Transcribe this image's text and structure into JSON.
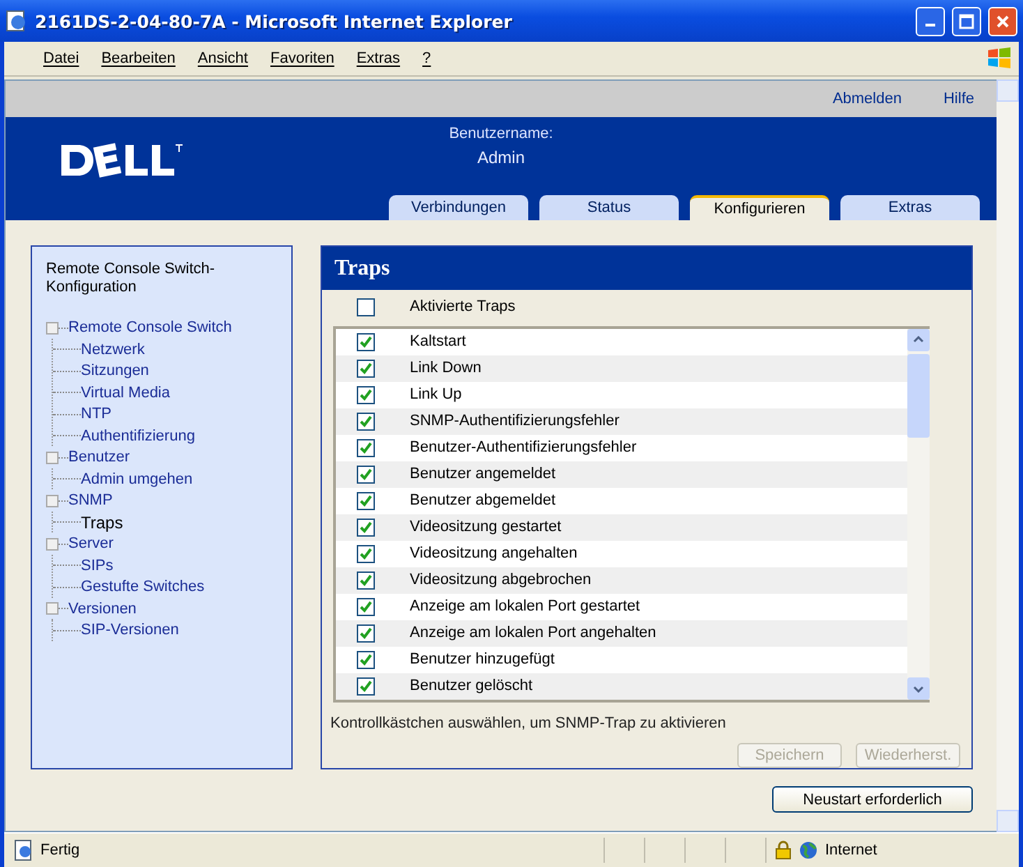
{
  "window": {
    "title": "2161DS-2-04-80-7A - Microsoft Internet Explorer"
  },
  "menu": [
    "Datei",
    "Bearbeiten",
    "Ansicht",
    "Favoriten",
    "Extras",
    "?"
  ],
  "top_links": [
    "Abmelden",
    "Hilfe"
  ],
  "user": {
    "label": "Benutzername:",
    "name": "Admin"
  },
  "tabs": [
    {
      "label": "Verbindungen",
      "selected": false
    },
    {
      "label": "Status",
      "selected": false
    },
    {
      "label": "Konfigurieren",
      "selected": true
    },
    {
      "label": "Extras",
      "selected": false
    }
  ],
  "sidebar": {
    "title": "Remote Console Switch-Konfiguration",
    "items": [
      {
        "label": "Remote Console Switch",
        "selected": false,
        "children": [
          {
            "label": "Netzwerk",
            "selected": false
          },
          {
            "label": "Sitzungen",
            "selected": false
          },
          {
            "label": "Virtual Media",
            "selected": false
          },
          {
            "label": "NTP",
            "selected": false
          },
          {
            "label": "Authentifizierung",
            "selected": false
          }
        ]
      },
      {
        "label": "Benutzer",
        "selected": false,
        "children": [
          {
            "label": "Admin umgehen",
            "selected": false
          }
        ]
      },
      {
        "label": "SNMP",
        "selected": false,
        "children": [
          {
            "label": "Traps",
            "selected": true
          }
        ]
      },
      {
        "label": "Server",
        "selected": false,
        "children": [
          {
            "label": "SIPs",
            "selected": false
          },
          {
            "label": "Gestufte Switches",
            "selected": false
          }
        ]
      },
      {
        "label": "Versionen",
        "selected": false,
        "children": [
          {
            "label": "SIP-Versionen",
            "selected": false
          }
        ]
      }
    ]
  },
  "panel": {
    "title": "Traps",
    "select_all": {
      "label": "Aktivierte Traps",
      "checked": false
    },
    "traps": [
      {
        "label": "Kaltstart",
        "checked": true
      },
      {
        "label": "Link Down",
        "checked": true
      },
      {
        "label": "Link Up",
        "checked": true
      },
      {
        "label": "SNMP-Authentifizierungsfehler",
        "checked": true
      },
      {
        "label": "Benutzer-Authentifizierungsfehler",
        "checked": true
      },
      {
        "label": "Benutzer angemeldet",
        "checked": true
      },
      {
        "label": "Benutzer abgemeldet",
        "checked": true
      },
      {
        "label": "Videositzung gestartet",
        "checked": true
      },
      {
        "label": "Videositzung angehalten",
        "checked": true
      },
      {
        "label": "Videositzung abgebrochen",
        "checked": true
      },
      {
        "label": "Anzeige am lokalen Port gestartet",
        "checked": true
      },
      {
        "label": "Anzeige am lokalen Port angehalten",
        "checked": true
      },
      {
        "label": "Benutzer hinzugefügt",
        "checked": true
      },
      {
        "label": "Benutzer gelöscht",
        "checked": true
      }
    ],
    "hint": "Kontrollkästchen auswählen, um SNMP-Trap zu aktivieren",
    "buttons": [
      {
        "label": "Speichern",
        "disabled": true
      },
      {
        "label": "Wiederherst.",
        "disabled": true
      }
    ]
  },
  "restart_button": "Neustart erforderlich",
  "status_bar": {
    "text": "Fertig",
    "zone": "Internet"
  }
}
